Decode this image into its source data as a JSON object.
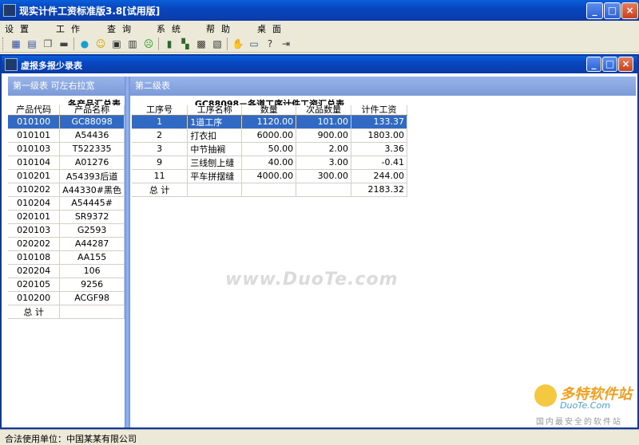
{
  "window": {
    "title": "现实计件工资标准版3.8[试用版]"
  },
  "menu": [
    "设置",
    "工作",
    "查询",
    "系统",
    "帮助",
    "桌面"
  ],
  "toolbar_icons": [
    "grid-icon",
    "list-icon",
    "copy-icon",
    "printer-icon",
    "edit-icon",
    "smile-icon",
    "form-icon",
    "table-icon",
    "sad-icon",
    "chart-icon",
    "tile-icon",
    "image-icon",
    "report-icon",
    "stop-icon",
    "monitor-icon",
    "help-icon",
    "exit-icon"
  ],
  "child": {
    "title": "虚报多报少录表"
  },
  "left": {
    "panel_label": "第一级表  可左右拉宽",
    "caption": "各产品汇总表",
    "columns": [
      "产品代码",
      "产品名称"
    ],
    "rows": [
      [
        "010100",
        "GC88098"
      ],
      [
        "010101",
        "A54436"
      ],
      [
        "010103",
        "T522335"
      ],
      [
        "010104",
        "A01276"
      ],
      [
        "010201",
        "A54393后道"
      ],
      [
        "010202",
        "A44330#黑色"
      ],
      [
        "010204",
        "A54445#"
      ],
      [
        "020101",
        "SR9372"
      ],
      [
        "020103",
        "G2593"
      ],
      [
        "020202",
        "A44287"
      ],
      [
        "010108",
        "AA155"
      ],
      [
        "020204",
        "106"
      ],
      [
        "020105",
        "9256"
      ],
      [
        "010200",
        "ACGF98"
      ]
    ],
    "total_label": "总  计"
  },
  "right": {
    "panel_label": "第二级表",
    "caption": "GC88098－各道工序计件工资汇总表",
    "columns": [
      "工序号",
      "工序名称",
      "数量",
      "次品数量",
      "计件工资"
    ],
    "rows": [
      [
        "1",
        "1道工序",
        "1120.00",
        "101.00",
        "133.37"
      ],
      [
        "2",
        "打衣扣",
        "6000.00",
        "900.00",
        "1803.00"
      ],
      [
        "3",
        "中节抽裥",
        "50.00",
        "2.00",
        "3.36"
      ],
      [
        "9",
        "三线刨上缝",
        "40.00",
        "3.00",
        "-0.41"
      ],
      [
        "11",
        "平车拼摆缝",
        "4000.00",
        "300.00",
        "244.00"
      ]
    ],
    "total_label": "总  计",
    "total_value": "2183.32"
  },
  "status": {
    "text": "合法使用单位：中国某某有限公司"
  },
  "watermark": "www.DuoTe.com",
  "corner_logo": {
    "line1": "多特软件站",
    "line2": "DuoTe.Com",
    "line3": "国内最安全的软件站"
  }
}
